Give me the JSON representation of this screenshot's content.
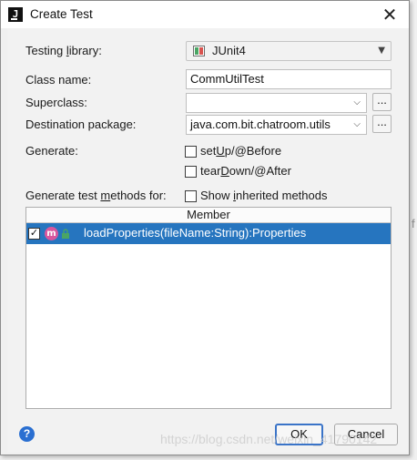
{
  "window": {
    "title": "Create Test",
    "app_icon": "J",
    "close_glyph": "✕"
  },
  "form": {
    "testing_library_label": "Testing library:",
    "testing_library_value": "JUnit4",
    "class_name_label": "Class name:",
    "class_name_value": "CommUtilTest",
    "superclass_label": "Superclass:",
    "superclass_value": "",
    "destination_label": "Destination package:",
    "destination_value": "java.com.bit.chatroom.utils",
    "browse_button_label": "...",
    "generate_label": "Generate:",
    "setup_label": "setUp/@Before",
    "setup_checked": false,
    "teardown_label": "tearDown/@After",
    "teardown_checked": false,
    "methods_label": "Generate test methods for:",
    "show_inherited_label": "Show inherited methods",
    "show_inherited_checked": false
  },
  "members_table": {
    "header": "Member",
    "rows": [
      {
        "checked": true,
        "icon": "m",
        "access_icon": "lock-icon",
        "signature": "loadProperties(fileName:String):Properties"
      }
    ]
  },
  "buttons": {
    "help_label": "?",
    "ok_label": "OK",
    "cancel_label": "Cancel"
  },
  "watermark": "https://blog.csdn.net/weixin_41790142",
  "colors": {
    "selection": "#2675bf",
    "method_icon": "#d9579e",
    "ok_border": "#3a74c8",
    "help": "#2a6fd1"
  }
}
